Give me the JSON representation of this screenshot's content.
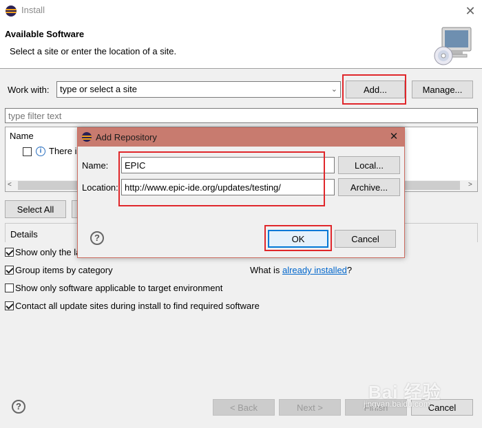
{
  "window": {
    "title": "Install"
  },
  "header": {
    "title": "Available Software",
    "subtitle": "Select a site or enter the location of a site."
  },
  "work_with": {
    "label": "Work with:",
    "value": "type or select a site",
    "add_label": "Add...",
    "manage_label": "Manage..."
  },
  "filter": {
    "placeholder": "type filter text"
  },
  "table": {
    "column_name": "Name",
    "row_text": "There is"
  },
  "buttons": {
    "select_all": "Select All"
  },
  "details": {
    "label": "Details",
    "options": [
      {
        "label": "Show only the la",
        "checked": true
      },
      {
        "label": "Group items by category",
        "checked": true
      },
      {
        "label": "Show only software applicable to target environment",
        "checked": false
      },
      {
        "label": "Contact all update sites during install to find required software",
        "checked": true
      }
    ],
    "what_is": "What is ",
    "already_installed": "already installed",
    "qmark": "?"
  },
  "footer": {
    "back": "< Back",
    "next": "Next >",
    "finish": "Finish",
    "cancel": "Cancel"
  },
  "dialog": {
    "title": "Add Repository",
    "name_label": "Name:",
    "name_value": "EPIC",
    "location_label": "Location:",
    "location_value": "http://www.epic-ide.org/updates/testing/",
    "local_label": "Local...",
    "archive_label": "Archive...",
    "ok_label": "OK",
    "cancel_label": "Cancel"
  },
  "watermark": {
    "text": "Bai 经验",
    "sub": "jingyan.baidu.com"
  },
  "colors": {
    "highlight_red": "#e0262a",
    "dialog_title": "#c87b6f",
    "link": "#0066cc",
    "primary_border": "#0078d7"
  },
  "icons": [
    "eclipse-icon",
    "close-icon",
    "cd-computer-icon",
    "chevron-down-icon",
    "info-icon",
    "help-icon",
    "chevron-left-icon",
    "chevron-right-icon"
  ]
}
